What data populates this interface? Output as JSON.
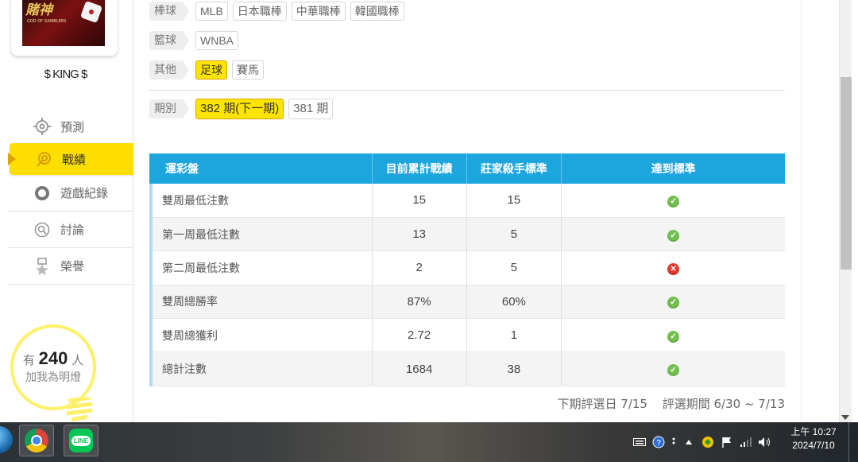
{
  "sidebar": {
    "logo": {
      "title": "賭神",
      "subtitle": "GOD OF GAMBLERS"
    },
    "username": "$ KING $",
    "nav": [
      {
        "label": "預測",
        "icon": "crosshair-icon"
      },
      {
        "label": "戰績",
        "icon": "target-icon"
      },
      {
        "label": "遊戲紀錄",
        "icon": "circle-icon"
      },
      {
        "label": "討論",
        "icon": "chat-search-icon"
      },
      {
        "label": "榮譽",
        "icon": "medal-icon"
      }
    ],
    "promo": {
      "prefix": "有",
      "count": "240",
      "suffix": "人",
      "line2": "加我為明燈"
    }
  },
  "filters": {
    "baseball": {
      "label": "棒球",
      "options": [
        "MLB",
        "日本職棒",
        "中華職棒",
        "韓國職棒"
      ]
    },
    "basketball": {
      "label": "籃球",
      "options": [
        "WNBA"
      ]
    },
    "other": {
      "label": "其他",
      "options": [
        "足球",
        "賽馬"
      ],
      "selected": "足球"
    },
    "period": {
      "label": "期別",
      "options": [
        "382 期(下一期)",
        "381 期"
      ],
      "selected": "382 期(下一期)"
    }
  },
  "table": {
    "headers": [
      "運彩盤",
      "目前累計戰績",
      "莊家殺手標準",
      "達到標準"
    ],
    "rows": [
      {
        "name": "雙周最低注數",
        "current": "15",
        "standard": "15",
        "met": true
      },
      {
        "name": "第一周最低注數",
        "current": "13",
        "standard": "5",
        "met": true
      },
      {
        "name": "第二周最低注數",
        "current": "2",
        "standard": "5",
        "met": false
      },
      {
        "name": "雙周總勝率",
        "current": "87%",
        "standard": "60%",
        "met": true
      },
      {
        "name": "雙周總獲利",
        "current": "2.72",
        "standard": "1",
        "met": true
      },
      {
        "name": "總計注數",
        "current": "1684",
        "standard": "38",
        "met": true
      }
    ]
  },
  "footer": {
    "next_eval": "下期評選日 7/15",
    "eval_period": "評選期間 6/30 ~ 7/13"
  },
  "taskbar": {
    "apps": [
      "chrome-icon",
      "line-icon"
    ],
    "line_label": "LINE",
    "clock_time": "上午 10:27",
    "clock_date": "2024/7/10"
  },
  "colors": {
    "accent_yellow": "#ffde00",
    "table_header_blue": "#1da5de",
    "ok_green": "#72c04f",
    "fail_red": "#e0392b"
  }
}
